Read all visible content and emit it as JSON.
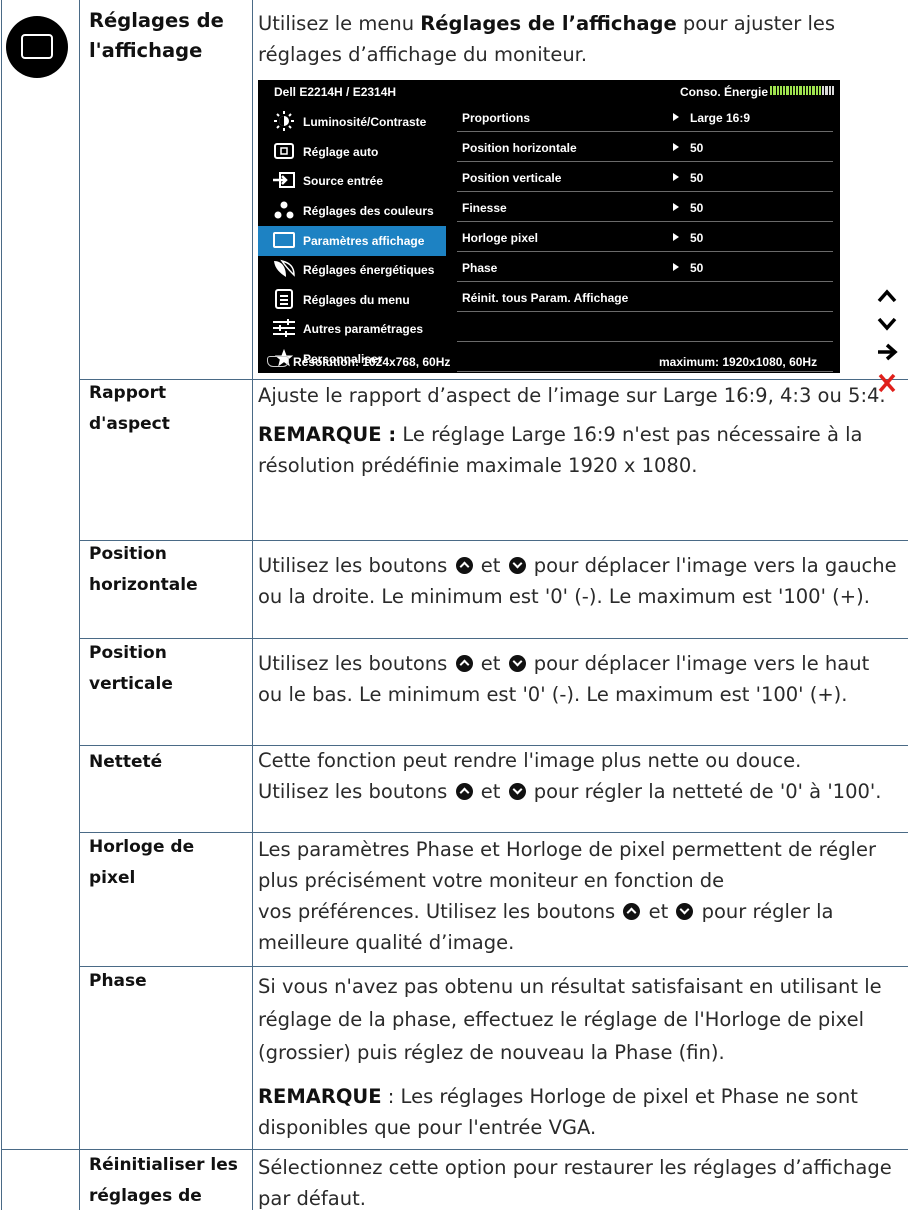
{
  "section": {
    "label": "Réglages de l'affichage",
    "intro_before": "Utilisez le menu ",
    "intro_bold": "Réglages de l’affichage",
    "intro_after": " pour ajuster les réglages d’affichage du moniteur."
  },
  "osd": {
    "title": "Dell E2214H / E2314H",
    "energy_label": "Conso. Énergie",
    "energy_level": 0.82,
    "menu": [
      {
        "icon": "brightness-contrast-icon",
        "label": "Luminosité/Contraste"
      },
      {
        "icon": "auto-adjust-icon",
        "label": "Réglage auto"
      },
      {
        "icon": "input-source-icon",
        "label": "Source entrée"
      },
      {
        "icon": "color-settings-icon",
        "label": "Réglages des couleurs"
      },
      {
        "icon": "display-settings-icon",
        "label": "Paramètres affichage",
        "active": true
      },
      {
        "icon": "energy-settings-icon",
        "label": "Réglages énergétiques"
      },
      {
        "icon": "menu-settings-icon",
        "label": "Réglages du menu"
      },
      {
        "icon": "other-settings-icon",
        "label": "Autres paramétrages"
      },
      {
        "icon": "star-icon",
        "label": "Personnaliser"
      }
    ],
    "params": [
      {
        "name": "Proportions",
        "value": "Large  16:9"
      },
      {
        "name": "Position horizontale",
        "value": "50"
      },
      {
        "name": "Position verticale",
        "value": "50"
      },
      {
        "name": "Finesse",
        "value": "50"
      },
      {
        "name": "Horloge pixel",
        "value": "50"
      },
      {
        "name": "Phase",
        "value": "50"
      },
      {
        "name": "Réinit. tous Param. Affichage",
        "value": ""
      }
    ],
    "resolution": "Résolution: 1024x768,  60Hz",
    "maximum": "maximum: 1920x1080,  60Hz"
  },
  "colors": {
    "accent": "#1d82c3",
    "meter": "#9fe24f",
    "close": "#e0201b"
  },
  "side_buttons": [
    "up-arrow-icon",
    "down-arrow-icon",
    "right-arrow-icon",
    "close-x-icon"
  ],
  "rows": [
    {
      "label": "Rapport d'aspect",
      "desc": "Ajuste le rapport d’aspect de l’image sur Large 16:9, 4:3 ou 5:4.",
      "note_label": "REMARQUE :",
      "note": " Le réglage Large 16:9 n'est pas nécessaire à la résolution prédéfinie maximale 1920 x 1080."
    },
    {
      "label": "Position horizontale",
      "p1": "Utilisez les boutons ",
      "p2": " et ",
      "p3": " pour déplacer l'image vers la gauche ou la droite. Le minimum est '0' (-). Le maximum est '100' (+)."
    },
    {
      "label": "Position verticale",
      "p1": " Utilisez les boutons ",
      "p2": " et ",
      "p3": " pour déplacer l'image vers le haut ou le bas. Le minimum est '0' (-). Le maximum est '100' (+)."
    },
    {
      "label": "Netteté",
      "p0": "Cette fonction peut rendre l'image plus nette ou douce.",
      "p1": "Utilisez les boutons ",
      "p2": " et ",
      "p3": " pour régler la netteté de '0' à '100'."
    },
    {
      "label": "Horloge de pixel",
      "p0": "Les paramètres Phase et Horloge de pixel permettent de régler plus précisément votre moniteur en fonction de",
      "p1": "vos préférences. Utilisez les boutons ",
      "p2": " et ",
      "p3": " pour régler la meilleure qualité d’image."
    },
    {
      "label": "Phase",
      "desc": "Si vous n'avez pas obtenu un résultat satisfaisant en utilisant le réglage de la phase, effectuez le réglage de l'Horloge de pixel (grossier) puis réglez de nouveau la Phase (fin).",
      "note_label": "REMARQUE",
      "note": " : Les réglages Horloge de pixel et Phase ne sont disponibles que pour l'entrée VGA."
    },
    {
      "label": "Réinitialiser les réglages de l'affichage",
      "desc": "Sélectionnez cette option pour restaurer les réglages d’affichage par défaut."
    }
  ]
}
